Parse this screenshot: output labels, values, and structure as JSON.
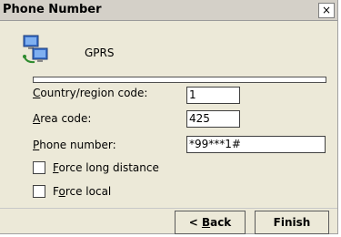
{
  "window": {
    "title": "Phone Number",
    "close_glyph": "×"
  },
  "connection": {
    "name": "GPRS",
    "icon": "network-connection-icon"
  },
  "form": {
    "country_label_u": "C",
    "country_label_rest": "ountry/region code:",
    "country_value": "1",
    "area_label_u": "A",
    "area_label_rest": "rea code:",
    "area_value": "425",
    "phone_label_u": "P",
    "phone_label_rest": "hone number:",
    "phone_value": "*99***1#",
    "force_long_u": "F",
    "force_long_rest": "orce long distance",
    "force_local_pre": "F",
    "force_local_u": "o",
    "force_local_rest": "rce local"
  },
  "buttons": {
    "back_pre": "< ",
    "back_u": "B",
    "back_rest": "ack",
    "finish": "Finish"
  }
}
